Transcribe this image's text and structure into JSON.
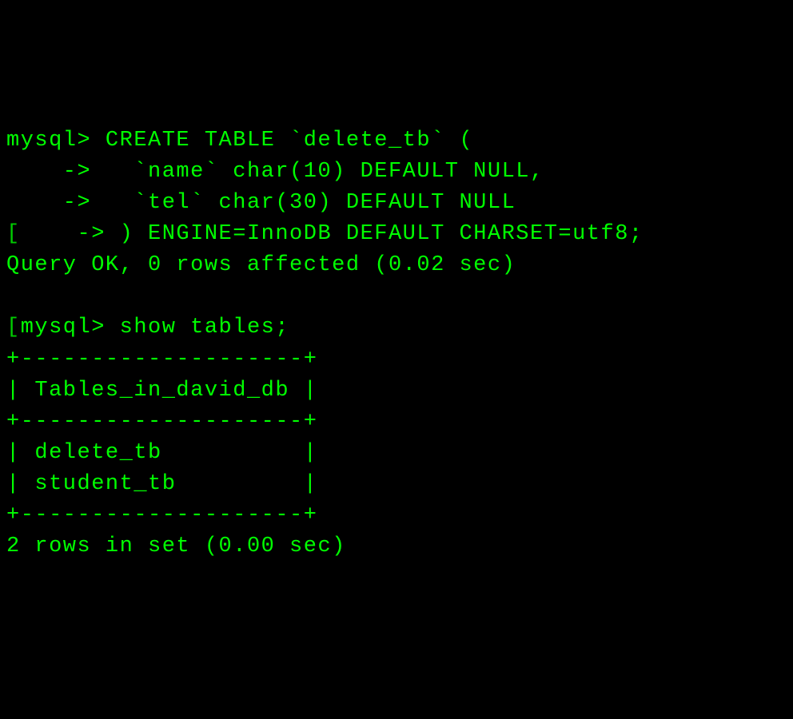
{
  "terminal": {
    "lines": [
      "mysql> CREATE TABLE `delete_tb` (",
      "    ->   `name` char(10) DEFAULT NULL,",
      "    ->   `tel` char(30) DEFAULT NULL",
      "    -> ) ENGINE=InnoDB DEFAULT CHARSET=utf8;",
      "Query OK, 0 rows affected (0.02 sec)",
      "",
      "mysql> show tables;",
      "+--------------------+",
      "| Tables_in_david_db |",
      "+--------------------+",
      "| delete_tb          |",
      "| student_tb         |",
      "+--------------------+",
      "2 rows in set (0.00 sec)"
    ],
    "bracket_lines": [
      3,
      6
    ]
  }
}
